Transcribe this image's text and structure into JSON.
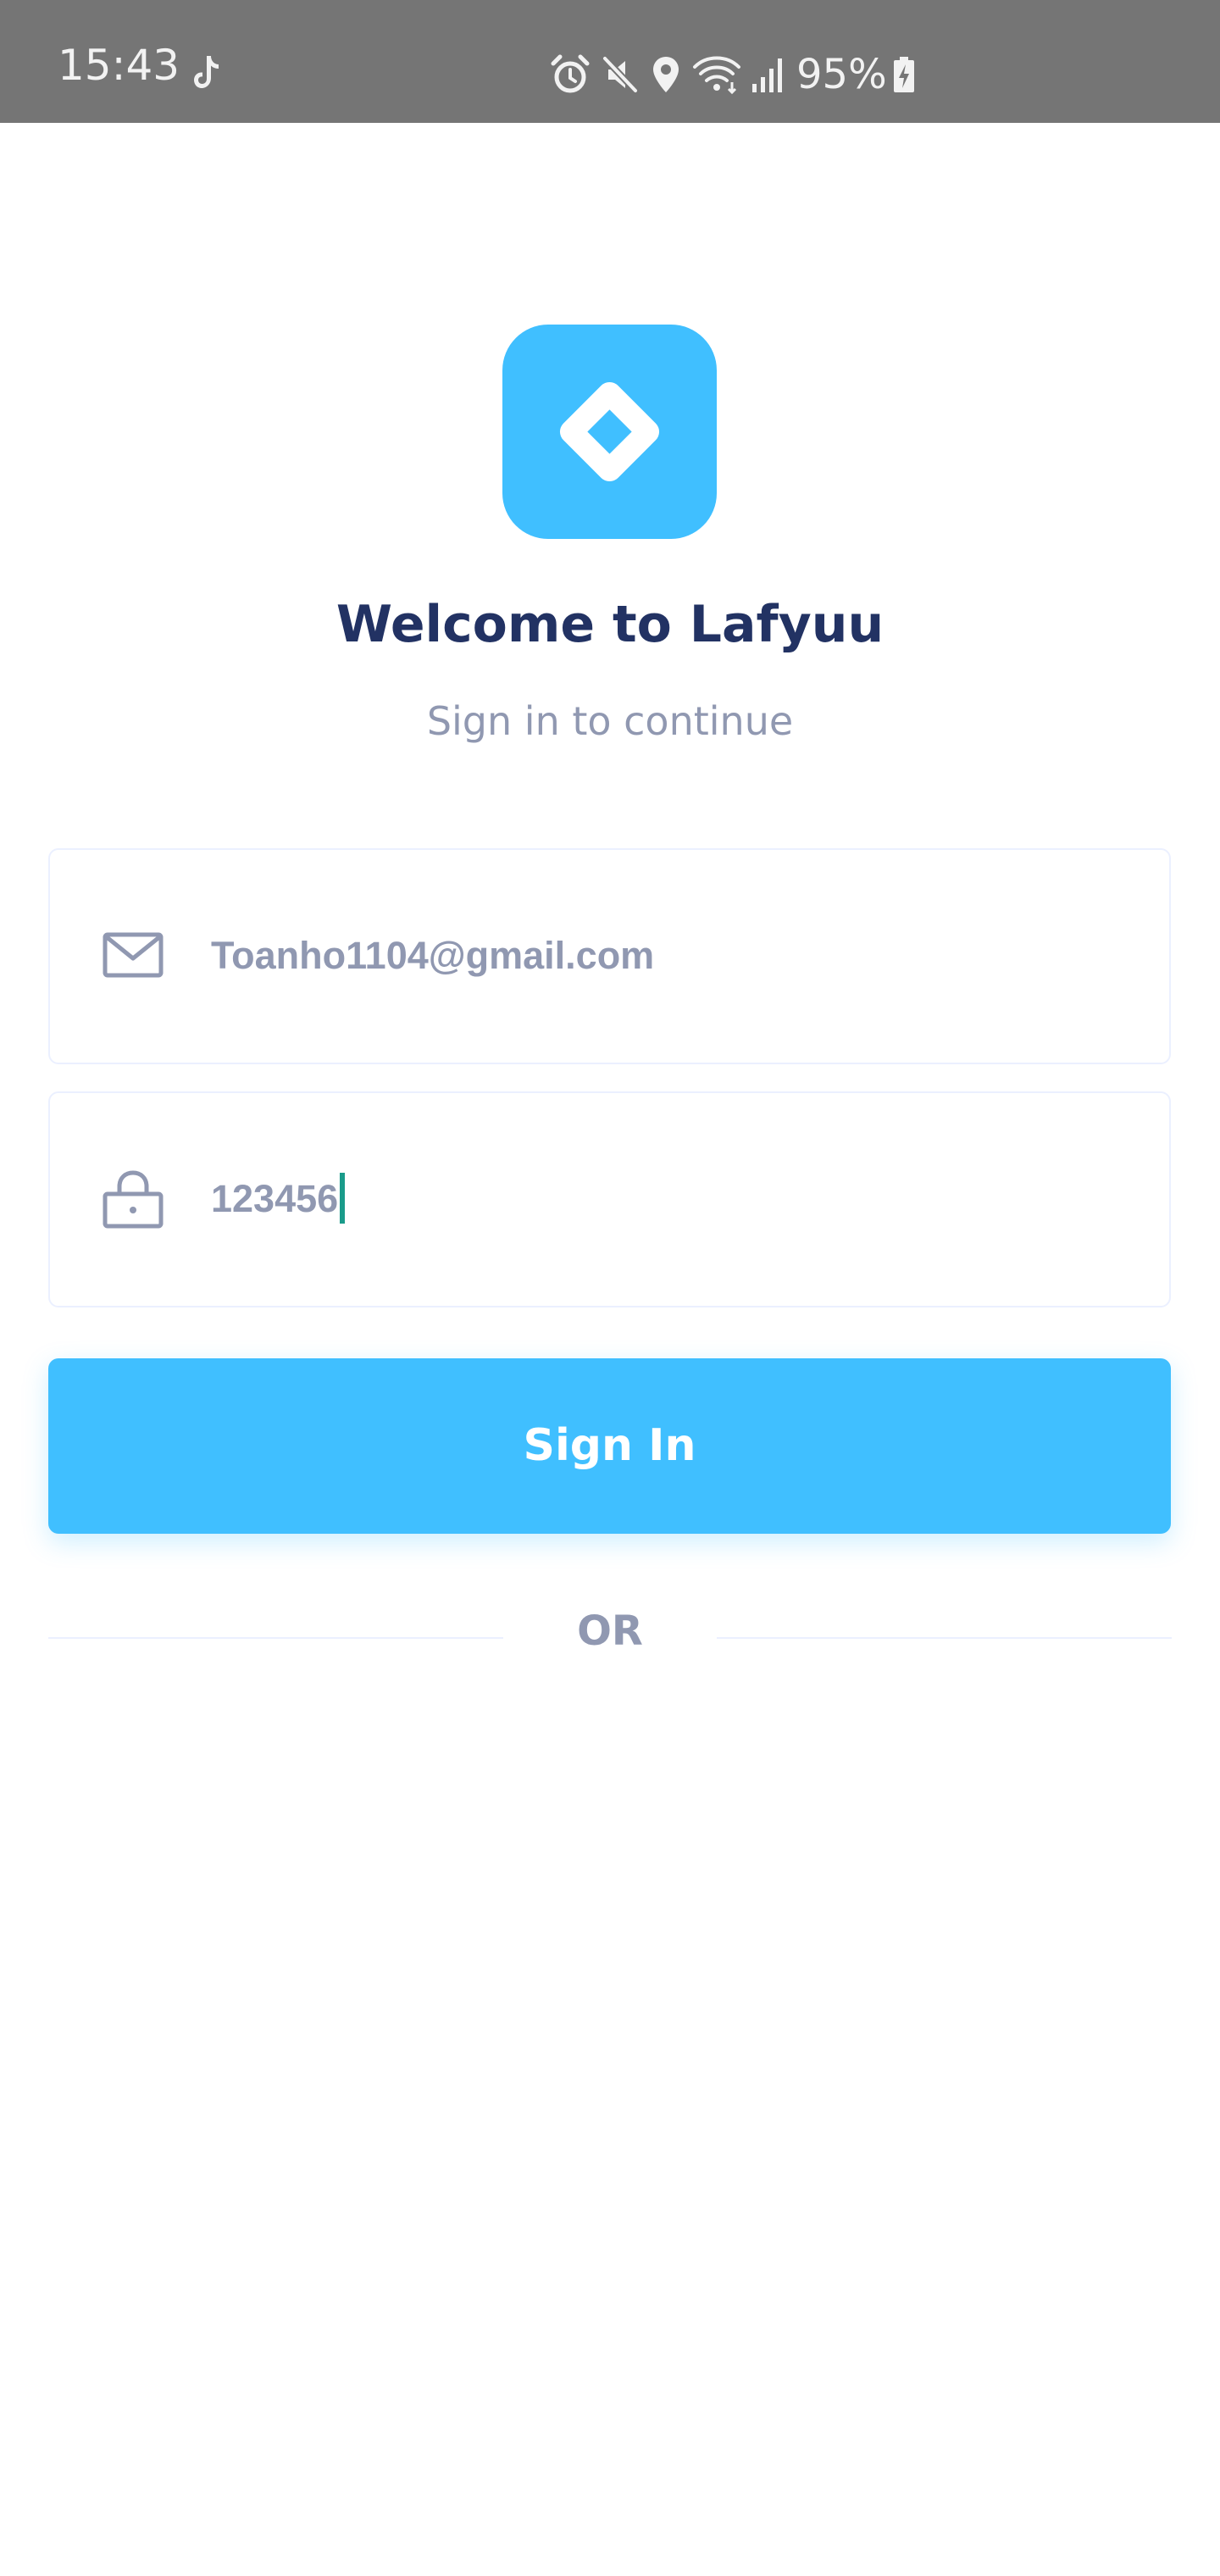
{
  "status_bar": {
    "time": "15:43",
    "battery": "95%",
    "icons": [
      "tiktok-icon",
      "alarm-icon",
      "mute-icon",
      "location-icon",
      "wifi-icon",
      "signal-icon",
      "battery-charging-icon"
    ],
    "background": "#757575"
  },
  "logo": {
    "icon": "diamond-logo-icon",
    "color": "#40bfff"
  },
  "welcome": {
    "title": "Welcome to Lafyuu",
    "subtitle": "Sign in to continue"
  },
  "form": {
    "email": {
      "icon": "mail-icon",
      "value": "Toanho1104@gmail.com"
    },
    "password": {
      "icon": "lock-icon",
      "value": "123456"
    },
    "sign_in_label": "Sign In",
    "or_label": "OR"
  },
  "colors": {
    "primary": "#40bfff",
    "title": "#223263",
    "muted": "#9098b1",
    "border": "#ebf0ff"
  }
}
